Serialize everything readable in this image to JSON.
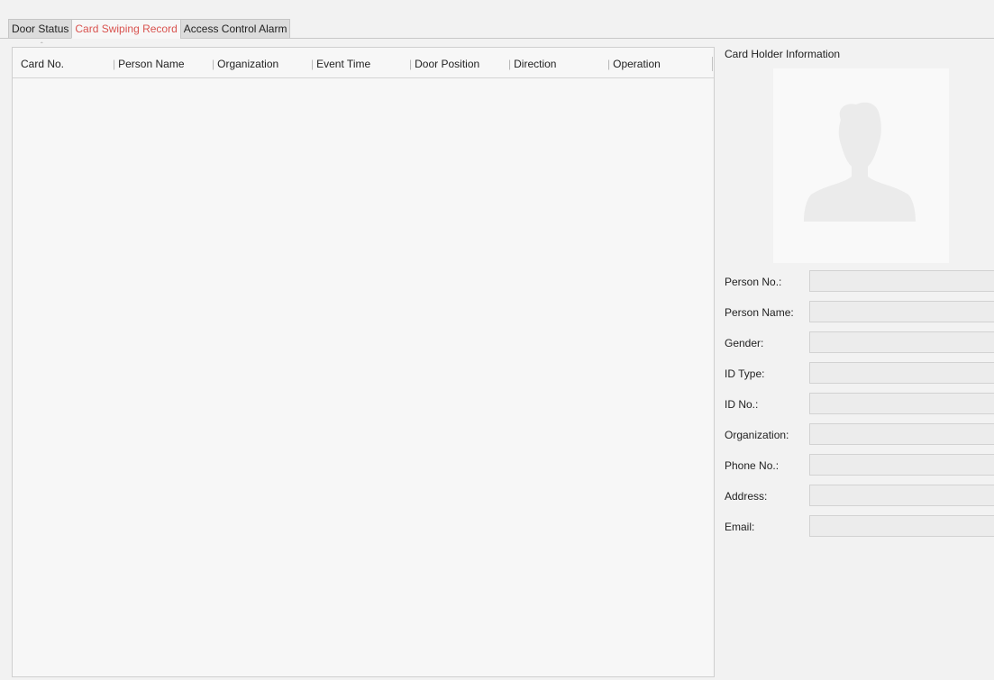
{
  "tabs": [
    {
      "label": "Door Status",
      "active": false
    },
    {
      "label": "Card Swiping Record",
      "active": true
    },
    {
      "label": "Access Control Alarm",
      "active": false
    }
  ],
  "table": {
    "columns": [
      "Card No.",
      "Person Name",
      "Organization",
      "Event Time",
      "Door Position",
      "Direction",
      "Operation"
    ],
    "sort_indicator": "ˆ",
    "rows": []
  },
  "card_holder": {
    "title": "Card Holder Information",
    "photo_icon": "person-silhouette-icon",
    "fields": [
      {
        "label": "Person No.:",
        "value": ""
      },
      {
        "label": "Person Name:",
        "value": ""
      },
      {
        "label": "Gender:",
        "value": ""
      },
      {
        "label": "ID Type:",
        "value": ""
      },
      {
        "label": "ID No.:",
        "value": ""
      },
      {
        "label": "Organization:",
        "value": ""
      },
      {
        "label": "Phone No.:",
        "value": ""
      },
      {
        "label": "Address:",
        "value": ""
      },
      {
        "label": "Email:",
        "value": ""
      }
    ]
  },
  "colors": {
    "active_tab_text": "#d9534f",
    "background": "#f2f2f2",
    "panel": "#f7f7f7",
    "field_bg": "#ececec",
    "silhouette": "#ebebeb"
  }
}
